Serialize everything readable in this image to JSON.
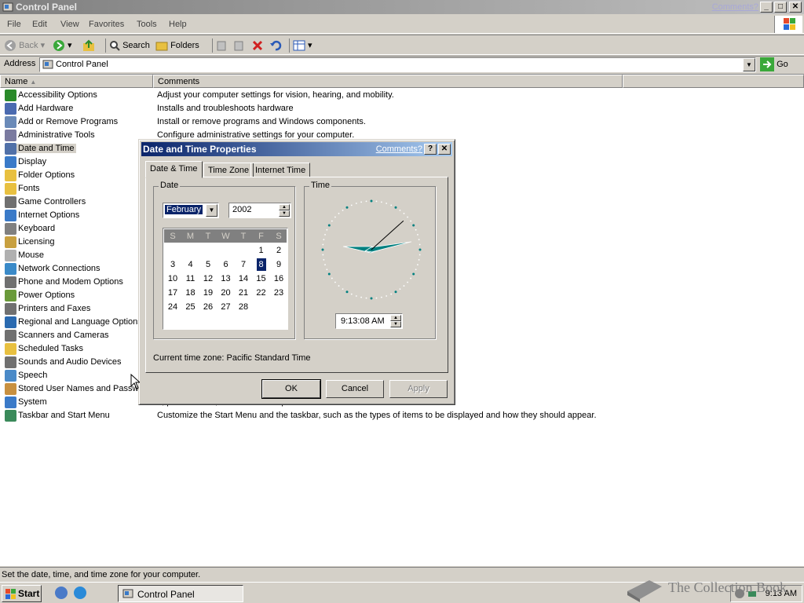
{
  "window": {
    "title": "Control Panel",
    "comments_link": "Comments?",
    "minimize": "_",
    "maximize": "□",
    "close": "✕"
  },
  "menu": {
    "items": [
      "File",
      "Edit",
      "View",
      "Favorites",
      "Tools",
      "Help"
    ]
  },
  "toolbar": {
    "back": "Back",
    "search": "Search",
    "folders": "Folders"
  },
  "address": {
    "label": "Address",
    "value": "Control Panel",
    "go": "Go"
  },
  "list": {
    "columns": {
      "name": "Name",
      "comments": "Comments"
    },
    "items": [
      {
        "name": "Accessibility Options",
        "comment": "Adjust your computer settings for vision, hearing, and mobility.",
        "color": "#2a8a2a"
      },
      {
        "name": "Add Hardware",
        "comment": "Installs and troubleshoots hardware",
        "color": "#4a6ab0"
      },
      {
        "name": "Add or Remove Programs",
        "comment": "Install or remove programs and Windows components.",
        "color": "#6a8ab8"
      },
      {
        "name": "Administrative Tools",
        "comment": "Configure administrative settings for your computer.",
        "color": "#7a7aa0"
      },
      {
        "name": "Date and Time",
        "comment": "",
        "color": "#5070a8"
      },
      {
        "name": "Display",
        "comment": "er, colors, font sizes, and screen resolution.",
        "color": "#3a7ac8"
      },
      {
        "name": "Folder Options",
        "comment": "etwork files available offline.",
        "color": "#e8c040"
      },
      {
        "name": "Fonts",
        "comment": "",
        "color": "#e8c040"
      },
      {
        "name": "Game Controllers",
        "comment": "mepads.",
        "color": "#707070"
      },
      {
        "name": "Internet Options",
        "comment": "",
        "color": "#3a7ac8"
      },
      {
        "name": "Keyboard",
        "comment": "ter repeat rate.",
        "color": "#808080"
      },
      {
        "name": "Licensing",
        "comment": "",
        "color": "#c8a040"
      },
      {
        "name": "Mouse",
        "comment": "speed, mouse pointers, and motion speed.",
        "color": "#b0b0b0"
      },
      {
        "name": "Network Connections",
        "comment": "",
        "color": "#3a8ac8"
      },
      {
        "name": "Phone and Modem Options",
        "comment": "",
        "color": "#707070"
      },
      {
        "name": "Power Options",
        "comment": "",
        "color": "#6a9a3a"
      },
      {
        "name": "Printers and Faxes",
        "comment": "",
        "color": "#707070"
      },
      {
        "name": "Regional and Language Options",
        "comment": "",
        "color": "#2a6ab0"
      },
      {
        "name": "Scanners and Cameras",
        "comment": "",
        "color": "#707070"
      },
      {
        "name": "Scheduled Tasks",
        "comment": "",
        "color": "#e8c040"
      },
      {
        "name": "Sounds and Audio Devices",
        "comment": "r speakers and recording devices.",
        "color": "#707070"
      },
      {
        "name": "Speech",
        "comment": "",
        "color": "#4a8ac8"
      },
      {
        "name": "Stored User Names and Passwo",
        "comment": "",
        "color": "#c89040"
      },
      {
        "name": "System",
        "comment": "e, performance, and automatic updates.",
        "color": "#3a7ac8"
      },
      {
        "name": "Taskbar and Start Menu",
        "comment": "Customize the Start Menu and the taskbar, such as the types of items to be displayed and how they should appear.",
        "color": "#3a8a5a"
      }
    ]
  },
  "status": "Set the date, time, and time zone for your computer.",
  "taskbar": {
    "start": "Start",
    "task": "Control Panel",
    "clock": "9:13 AM"
  },
  "watermark": "The Collection Book",
  "dialog": {
    "title": "Date and Time Properties",
    "comments_link": "Comments?",
    "help": "?",
    "close": "✕",
    "tabs": [
      "Date & Time",
      "Time Zone",
      "Internet Time"
    ],
    "date_group": "Date",
    "time_group": "Time",
    "month": "February",
    "year": "2002",
    "day_headers": [
      "S",
      "M",
      "T",
      "W",
      "T",
      "F",
      "S"
    ],
    "first_weekday": 5,
    "days_in_month": 28,
    "selected_day": 8,
    "time": "9:13:08 AM",
    "hour": 9,
    "minute": 13,
    "second": 8,
    "timezone": "Current time zone:  Pacific Standard Time",
    "ok": "OK",
    "cancel": "Cancel",
    "apply": "Apply"
  }
}
